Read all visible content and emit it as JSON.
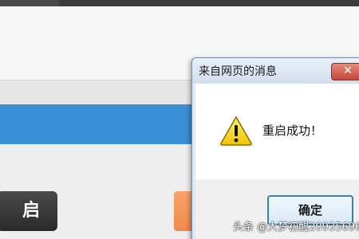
{
  "background": {
    "restart_button_label": "启",
    "accent_color": "#3a8fd6",
    "orange_button_color": "#f08a4b"
  },
  "dialog": {
    "title": "来自网页的消息",
    "close_label": "✕",
    "icon": "warning-icon",
    "message": "重启成功！",
    "ok_label": "确定"
  },
  "watermark": {
    "text": "头条 @大梦初醒209356965"
  }
}
